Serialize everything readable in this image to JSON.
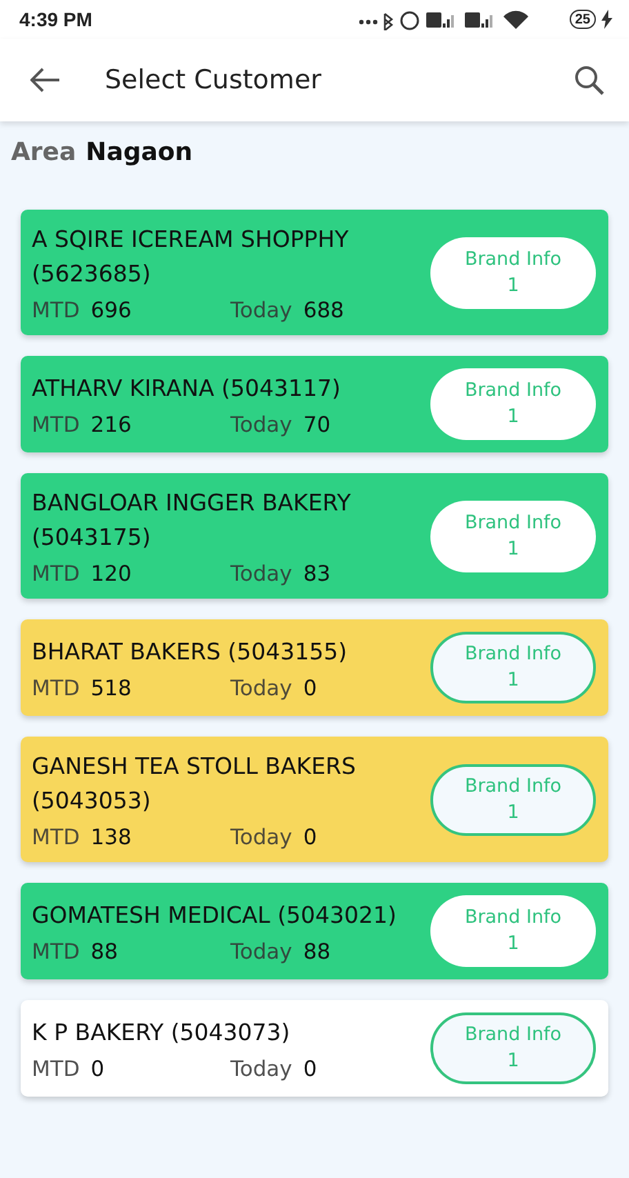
{
  "status_bar": {
    "time": "4:39 PM",
    "battery": "25"
  },
  "app_bar": {
    "title": "Select Customer"
  },
  "area": {
    "label": "Area",
    "value": "Nagaon"
  },
  "customers": [
    {
      "name": "A SQIRE  ICEREAM SHOPPHY (5623685)",
      "mtd_label": "MTD",
      "mtd": "696",
      "today_label": "Today",
      "today": "688",
      "color": "#2ed184",
      "button": {
        "label": "Brand Info",
        "count": "1",
        "outlined": false
      }
    },
    {
      "name": "ATHARV KIRANA (5043117)",
      "mtd_label": "MTD",
      "mtd": "216",
      "today_label": "Today",
      "today": "70",
      "color": "#2ed184",
      "button": {
        "label": "Brand Info",
        "count": "1",
        "outlined": false
      }
    },
    {
      "name": "BANGLOAR INGGER BAKERY (5043175)",
      "mtd_label": "MTD",
      "mtd": "120",
      "today_label": "Today",
      "today": "83",
      "color": "#2ed184",
      "button": {
        "label": "Brand Info",
        "count": "1",
        "outlined": false
      }
    },
    {
      "name": "BHARAT BAKERS (5043155)",
      "mtd_label": "MTD",
      "mtd": "518",
      "today_label": "Today",
      "today": "0",
      "color": "#f7d75c",
      "button": {
        "label": "Brand Info",
        "count": "1",
        "outlined": true
      }
    },
    {
      "name": "GANESH TEA STOLL BAKERS (5043053)",
      "mtd_label": "MTD",
      "mtd": "138",
      "today_label": "Today",
      "today": "0",
      "color": "#f7d75c",
      "button": {
        "label": "Brand Info",
        "count": "1",
        "outlined": true
      }
    },
    {
      "name": "GOMATESH MEDICAL (5043021)",
      "mtd_label": "MTD",
      "mtd": "88",
      "today_label": "Today",
      "today": "88",
      "color": "#2ed184",
      "button": {
        "label": "Brand Info",
        "count": "1",
        "outlined": false
      }
    },
    {
      "name": "K P BAKERY (5043073)",
      "mtd_label": "MTD",
      "mtd": "0",
      "today_label": "Today",
      "today": "0",
      "color": "#ffffff",
      "button": {
        "label": "Brand Info",
        "count": "1",
        "outlined": true
      }
    }
  ]
}
